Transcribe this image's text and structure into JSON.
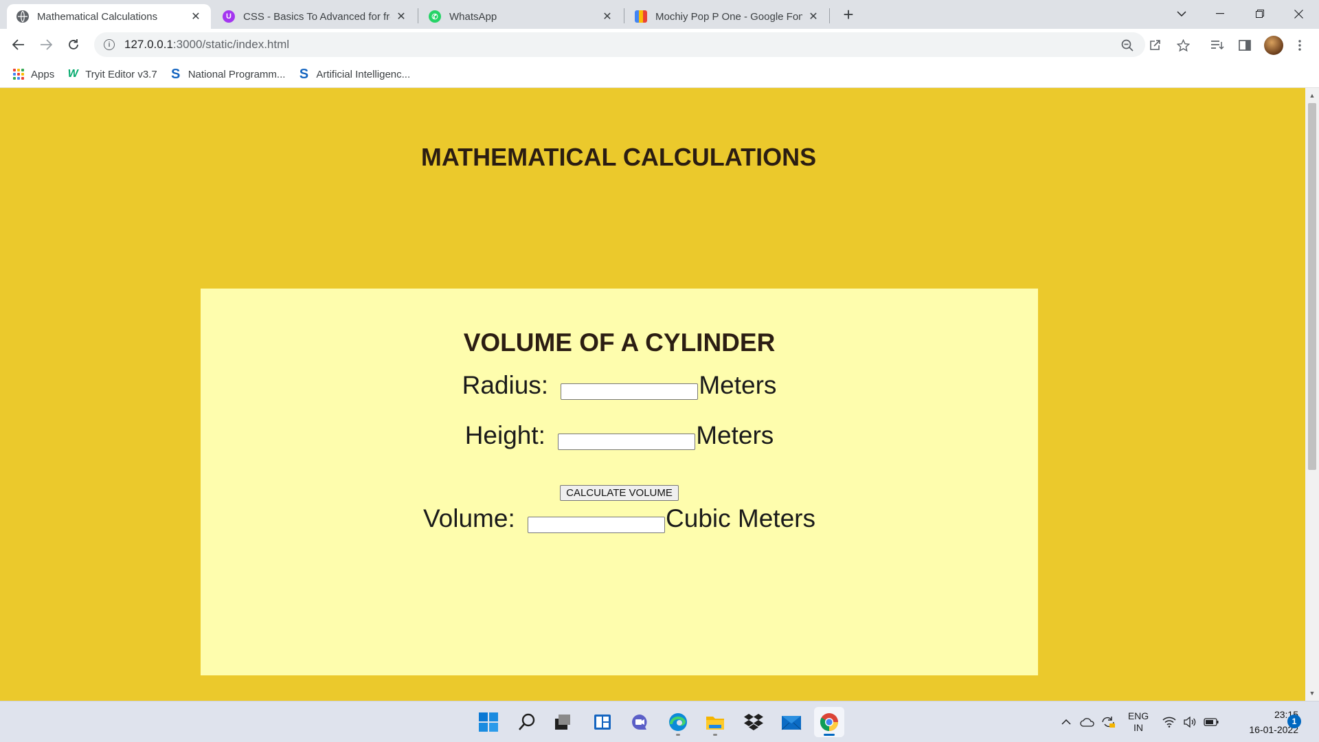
{
  "browser": {
    "tabs": [
      {
        "label": "Mathematical Calculations",
        "icon": "globe-icon",
        "active": true
      },
      {
        "label": "CSS - Basics To Advanced for fror",
        "icon": "udemy-icon",
        "active": false
      },
      {
        "label": "WhatsApp",
        "icon": "whatsapp-icon",
        "active": false
      },
      {
        "label": "Mochiy Pop P One - Google Font",
        "icon": "google-fonts-icon",
        "active": false
      }
    ],
    "url_host": "127.0.0.1",
    "url_path": ":3000/static/index.html"
  },
  "bookmarks": [
    {
      "label": "Apps",
      "icon": "apps-grid-icon"
    },
    {
      "label": "Tryit Editor v3.7",
      "icon": "w3schools-icon"
    },
    {
      "label": "National Programm...",
      "icon": "swayam-icon"
    },
    {
      "label": "Artificial Intelligenc...",
      "icon": "swayam-icon"
    }
  ],
  "page": {
    "title": "MATHEMATICAL CALCULATIONS",
    "card": {
      "heading": "VOLUME OF A CYLINDER",
      "radius_label": "Radius:",
      "radius_value": "",
      "radius_unit": "Meters",
      "height_label": "Height:",
      "height_value": "",
      "height_unit": "Meters",
      "button_label": "CALCULATE VOLUME",
      "volume_label": "Volume:",
      "volume_value": "",
      "volume_unit": "Cubic Meters"
    }
  },
  "colors": {
    "page_background": "#ebc92c",
    "card_background": "#fefdad",
    "heading_text": "#2b1d12"
  },
  "system_tray": {
    "language": "ENG",
    "region": "IN",
    "time": "23:15",
    "date": "16-01-2022",
    "notification_count": "1"
  }
}
